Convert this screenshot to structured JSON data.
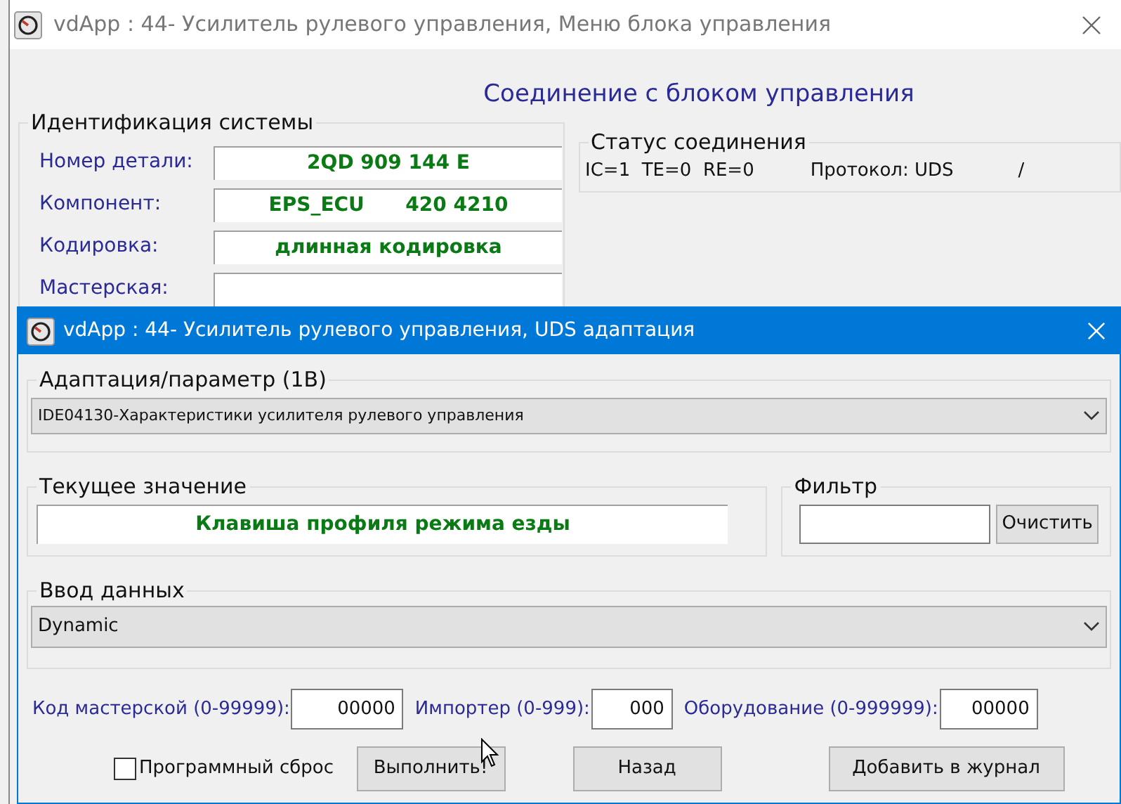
{
  "back_window": {
    "title": "vdApp : 44- Усилитель рулевого управления,  Меню блока управления",
    "heading": "Соединение с блоком управления",
    "identification": {
      "title": "Идентификация системы",
      "rows": [
        {
          "label": "Номер детали:",
          "value": "2QD 909 144 E"
        },
        {
          "label": "Компонент:",
          "value": "EPS_ECU      420 4210"
        },
        {
          "label": "Кодировка:",
          "value": "длинная кодировка"
        },
        {
          "label": "Мастерская:"
        }
      ]
    },
    "status": {
      "title": "Статус соединения",
      "text": "IC=1  TE=0  RE=0",
      "protocol": "Протокол: UDS",
      "extra": "/"
    }
  },
  "front_window": {
    "title": "vdApp : 44- Усилитель рулевого управления,  UDS адаптация",
    "adaptation": {
      "title": "Адаптация/параметр (1B)",
      "value": "IDE04130-Характеристики усилителя рулевого управления"
    },
    "current": {
      "title": "Текущее значение",
      "value": "Клавиша профиля режима езды"
    },
    "filter": {
      "title": "Фильтр",
      "button": "Очистить"
    },
    "input": {
      "title": "Ввод данных",
      "value": "Dynamic"
    },
    "codes": [
      {
        "label": "Код мастерской (0-99999):",
        "value": "00000"
      },
      {
        "label": "Импортер (0-999):",
        "value": "000"
      },
      {
        "label": "Оборудование (0-999999):",
        "value": "00000"
      }
    ],
    "reset": {
      "label": "Программный сброс",
      "checked": false
    },
    "buttons": [
      "Выполнить!",
      "Назад",
      "Добавить в журнал"
    ]
  }
}
